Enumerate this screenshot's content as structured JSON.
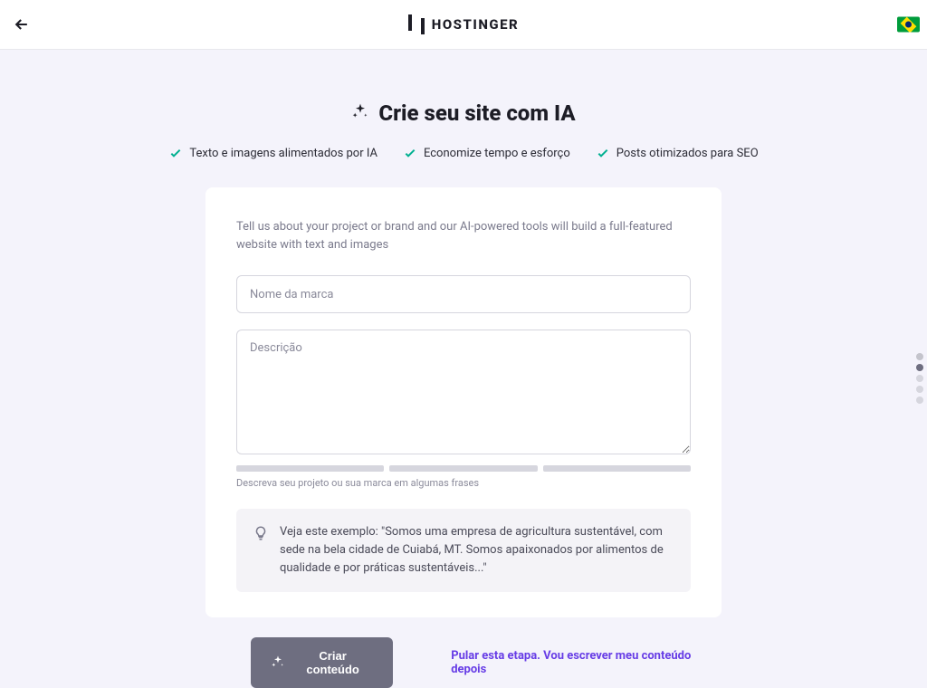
{
  "header": {
    "brand": "HOSTINGER"
  },
  "title": "Crie seu site com IA",
  "features": [
    "Texto e imagens alimentados por IA",
    "Economize tempo e esforço",
    "Posts otimizados para SEO"
  ],
  "card": {
    "intro": "Tell us about your project or brand and our AI-powered tools will build a full-featured website with text and images",
    "brand_placeholder": "Nome da marca",
    "desc_placeholder": "Descrição",
    "helper": "Descreva seu projeto ou sua marca em algumas frases",
    "tip": "Veja este exemplo: \"Somos uma empresa de agricultura sustentável, com sede na bela cidade de Cuiabá, MT. Somos apaixonados por alimentos de qualidade e por práticas sustentáveis...\""
  },
  "actions": {
    "primary": "Criar conteúdo",
    "skip": "Pular esta etapa. Vou escrever meu conteúdo depois"
  }
}
